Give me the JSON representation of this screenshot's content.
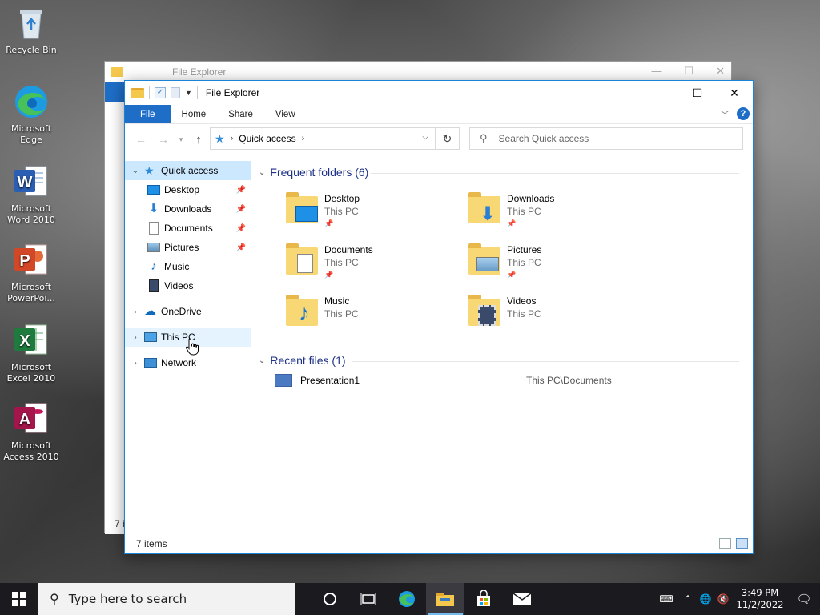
{
  "desktop": {
    "icons": [
      {
        "label": "Recycle Bin",
        "icon": "recycle-bin-icon"
      },
      {
        "label": "Microsoft Edge",
        "icon": "edge-icon"
      },
      {
        "label": "Microsoft Word 2010",
        "icon": "word-icon"
      },
      {
        "label": "Microsoft PowerPoi...",
        "icon": "powerpoint-icon"
      },
      {
        "label": "Microsoft Excel 2010",
        "icon": "excel-icon"
      },
      {
        "label": "Microsoft Access 2010",
        "icon": "access-icon"
      }
    ]
  },
  "background_window": {
    "title": "File Explorer",
    "status": "7 i"
  },
  "window": {
    "title": "File Explorer",
    "controls": {
      "minimize": "—",
      "maximize": "☐",
      "close": "✕"
    }
  },
  "ribbon": {
    "tabs": [
      "File",
      "Home",
      "Share",
      "View"
    ],
    "help": "?"
  },
  "address": {
    "crumb": "Quick access",
    "search_placeholder": "Search Quick access"
  },
  "nav": {
    "quick_access": "Quick access",
    "pinned": [
      "Desktop",
      "Downloads",
      "Documents",
      "Pictures"
    ],
    "unpinned": [
      "Music",
      "Videos"
    ],
    "roots": [
      "OneDrive",
      "This PC",
      "Network"
    ]
  },
  "content": {
    "frequent_header": "Frequent folders (6)",
    "folders": [
      {
        "name": "Desktop",
        "location": "This PC",
        "pinned": true
      },
      {
        "name": "Downloads",
        "location": "This PC",
        "pinned": true
      },
      {
        "name": "Documents",
        "location": "This PC",
        "pinned": true
      },
      {
        "name": "Pictures",
        "location": "This PC",
        "pinned": true
      },
      {
        "name": "Music",
        "location": "This PC",
        "pinned": false
      },
      {
        "name": "Videos",
        "location": "This PC",
        "pinned": false
      }
    ],
    "recent_header": "Recent files (1)",
    "recent": [
      {
        "name": "Presentation1",
        "path": "This PC\\Documents"
      }
    ]
  },
  "status": {
    "items": "7 items"
  },
  "taskbar": {
    "search_text": "Type here to search",
    "time": "3:49 PM",
    "date": "11/2/2022"
  },
  "colors": {
    "accent": "#1e6ec8",
    "selected_nav": "#cce8ff",
    "group_header": "#1e3287"
  }
}
